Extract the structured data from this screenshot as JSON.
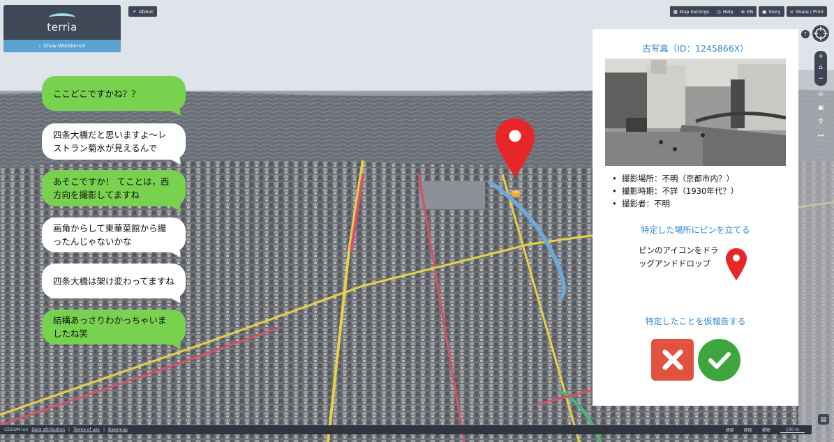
{
  "app": {
    "brand": "terria",
    "workbench_label": "Show Workbench",
    "about_label": "About"
  },
  "toolbar": {
    "map_settings": "Map Settings",
    "help": "Help",
    "lang": "EN",
    "story": "Story",
    "share": "Share / Print"
  },
  "chat": [
    {
      "text": "ここどこですかね？？",
      "style": "green"
    },
    {
      "text": "四条大橋だと思いますよ〜レストラン菊水が見えるんで",
      "style": "white"
    },
    {
      "text": "あそこですか！ てことは，西方向を撮影してますね",
      "style": "green"
    },
    {
      "text": "画角からして東華菜館から撮ったんじゃないかな",
      "style": "white"
    },
    {
      "text": "四条大橋は架け変わってますね",
      "style": "white"
    },
    {
      "text": "結構あっさりわかっちゃいましたね笑",
      "style": "green"
    }
  ],
  "panel": {
    "title": "古写真（ID：1245866X）",
    "info": [
      "撮影場所：不明（京都市内？）",
      "撮影時期：不詳（1930年代？）",
      "撮影者：不明"
    ],
    "pin_heading": "特定した場所にピンを立てる",
    "pin_instruction": "ピンのアイコンをドラッグアンドドロップ",
    "report_heading": "特定したことを仮報告する"
  },
  "footer": {
    "cesium": "CESIUM ion",
    "data_attribution": "Data attribution",
    "terms": "Terms of use",
    "basemap": "Basemap",
    "lat": "緯度",
    "lon": "経度",
    "elev": "標高",
    "scale": "100 m"
  },
  "colors": {
    "pin": "#e8262a",
    "green_bubble": "#79d24f",
    "accent": "#2f88d3",
    "reject": "#e1533f",
    "accept": "#3ea63c"
  },
  "icons": [
    "map-pin-icon",
    "close-icon",
    "check-icon",
    "compass-icon",
    "zoom-in-icon",
    "zoom-out-icon",
    "home-icon",
    "locate-icon",
    "chat-icon"
  ]
}
